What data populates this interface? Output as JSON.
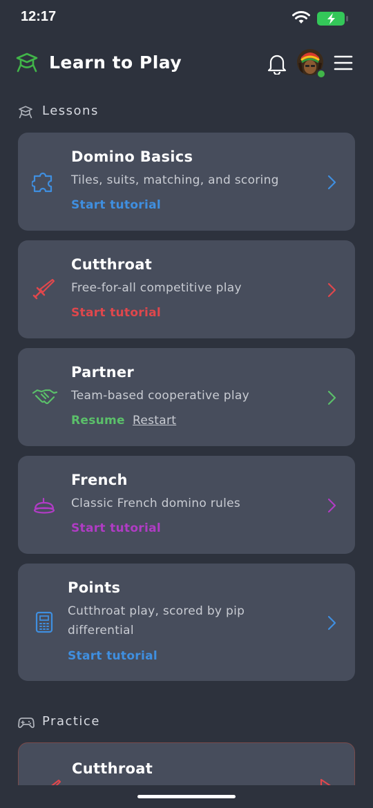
{
  "status_bar": {
    "time": "12:17",
    "battery_color": "#34c759"
  },
  "header": {
    "title": "Learn to Play",
    "logo_icon": "graduation-cap-icon",
    "accent": "#41b549"
  },
  "lessons": {
    "label": "Lessons",
    "items": [
      {
        "title": "Domino Basics",
        "desc": "Tiles, suits, matching, and scoring",
        "action": "Start tutorial",
        "color": "#3f8fe0",
        "icon": "puzzle-icon"
      },
      {
        "title": "Cutthroat",
        "desc": "Free-for-all competitive play",
        "action": "Start tutorial",
        "color": "#e0474c",
        "icon": "sword-icon"
      },
      {
        "title": "Partner",
        "desc": "Team-based cooperative play",
        "action": "Resume",
        "secondary_action": "Restart",
        "color": "#5bc06a",
        "icon": "handshake-icon"
      },
      {
        "title": "French",
        "desc": "Classic French domino rules",
        "action": "Start tutorial",
        "color": "#b03cc4",
        "icon": "beret-icon"
      },
      {
        "title": "Points",
        "desc": "Cutthroat play, scored by pip differential",
        "action": "Start tutorial",
        "color": "#3f8fe0",
        "icon": "calculator-icon"
      }
    ]
  },
  "practice": {
    "label": "Practice",
    "items": [
      {
        "title": "Cutthroat",
        "color": "#e0474c"
      }
    ]
  }
}
